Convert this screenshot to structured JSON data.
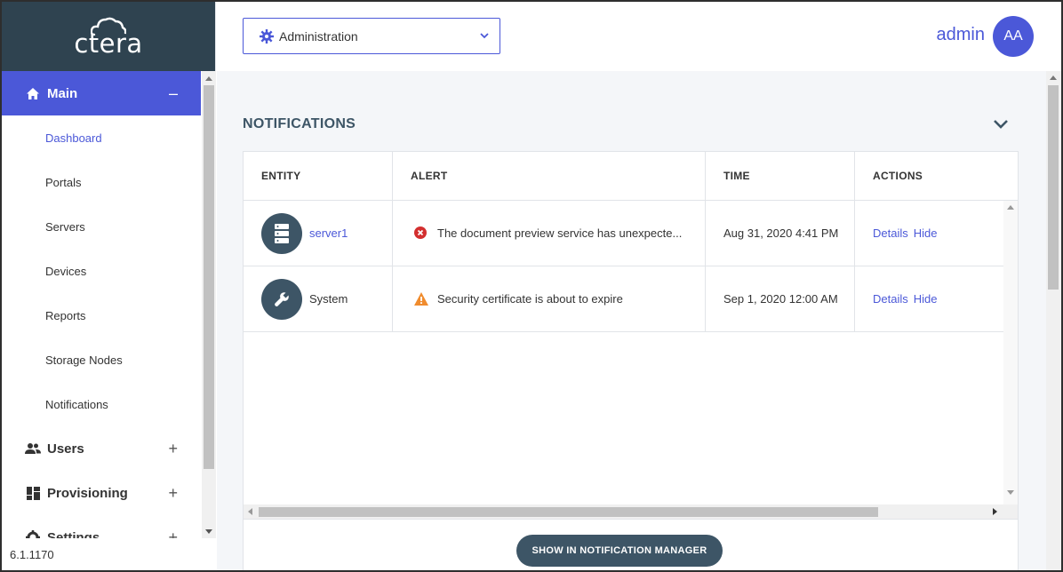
{
  "brand": {
    "logo_text": "ctera"
  },
  "sidebar": {
    "groups": [
      {
        "label": "Main",
        "toggle": "–",
        "icon": "home-icon",
        "active": true
      },
      {
        "label": "Users",
        "toggle": "+",
        "icon": "users-icon"
      },
      {
        "label": "Provisioning",
        "toggle": "+",
        "icon": "provisioning-icon"
      },
      {
        "label": "Settings",
        "toggle": "+",
        "icon": "settings-icon"
      }
    ],
    "main_items": [
      {
        "label": "Dashboard",
        "selected": true
      },
      {
        "label": "Portals"
      },
      {
        "label": "Servers"
      },
      {
        "label": "Devices"
      },
      {
        "label": "Reports"
      },
      {
        "label": "Storage Nodes"
      },
      {
        "label": "Notifications"
      }
    ],
    "version": "6.1.1170"
  },
  "header": {
    "context_select": {
      "value": "Administration",
      "icon": "gear-icon"
    },
    "user": {
      "name": "admin",
      "initials": "AA"
    }
  },
  "notifications": {
    "title": "NOTIFICATIONS",
    "columns": [
      "ENTITY",
      "ALERT",
      "TIME",
      "ACTIONS"
    ],
    "rows": [
      {
        "entity": "server1",
        "entity_icon": "server-icon",
        "alert_icon": "error-icon",
        "alert": "The document preview service has unexpecte...",
        "time": "Aug 31, 2020 4:41 PM",
        "actions": [
          "Details",
          "Hide"
        ]
      },
      {
        "entity": "System",
        "entity_icon": "wrench-icon",
        "alert_icon": "warning-icon",
        "alert": "Security certificate is about to expire",
        "time": "Sep 1, 2020 12:00 AM",
        "actions": [
          "Details",
          "Hide"
        ]
      }
    ],
    "show_button": "SHOW IN NOTIFICATION MANAGER"
  },
  "colors": {
    "accent": "#4b58d8",
    "sidebar_header": "#2f4350",
    "entity_icon_bg": "#3d5566",
    "error": "#d32f2f",
    "warning": "#f08c2e"
  }
}
